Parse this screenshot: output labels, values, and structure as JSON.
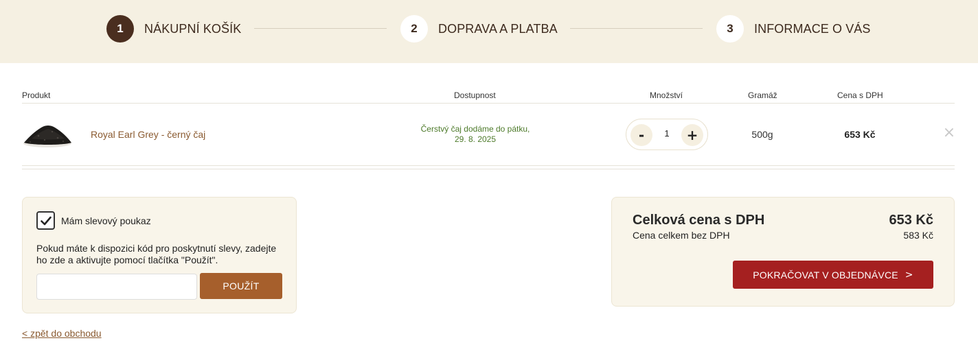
{
  "steps": [
    {
      "number": "1",
      "label": "NÁKUPNÍ KOŠÍK"
    },
    {
      "number": "2",
      "label": "DOPRAVA A PLATBA"
    },
    {
      "number": "3",
      "label": "INFORMACE O VÁS"
    }
  ],
  "table": {
    "headers": {
      "product": "Produkt",
      "availability": "Dostupnost",
      "quantity": "Množství",
      "weight": "Gramáž",
      "price": "Cena s DPH"
    },
    "rows": [
      {
        "name": "Royal Earl Grey - černý čaj",
        "availability_line1": "Čerstvý čaj dodáme do pátku,",
        "availability_line2": "29. 8. 2025",
        "quantity": "1",
        "minus_label": "-",
        "plus_label": "+",
        "weight": "500g",
        "price": "653 Kč",
        "remove_icon": "close-icon"
      }
    ]
  },
  "voucher": {
    "checkbox_label": "Mám slevový poukaz",
    "checked": true,
    "description": "Pokud máte k dispozici kód pro poskytnutí slevy, zadejte ho zde a aktivujte pomocí tlačítka \"Použít\".",
    "input_value": "",
    "input_placeholder": "",
    "apply_label": "POUŽÍT"
  },
  "summary": {
    "title": "Celková cena s DPH",
    "total": "653 Kč",
    "subtitle": "Cena celkem bez DPH",
    "subtotal": "583 Kč",
    "continue_label": "POKRAČOVAT V OBJEDNÁVCE",
    "continue_arrow": ">"
  },
  "back_link": "< zpět do obchodu",
  "colors": {
    "header_bg": "#f5f0e2",
    "active_step": "#4a2e1f",
    "link_brown": "#8a5a30",
    "apply_button": "#a65f2c",
    "continue_button": "#a52020",
    "availability_green": "#4d7a2a",
    "box_bg": "#f9f5ea"
  }
}
